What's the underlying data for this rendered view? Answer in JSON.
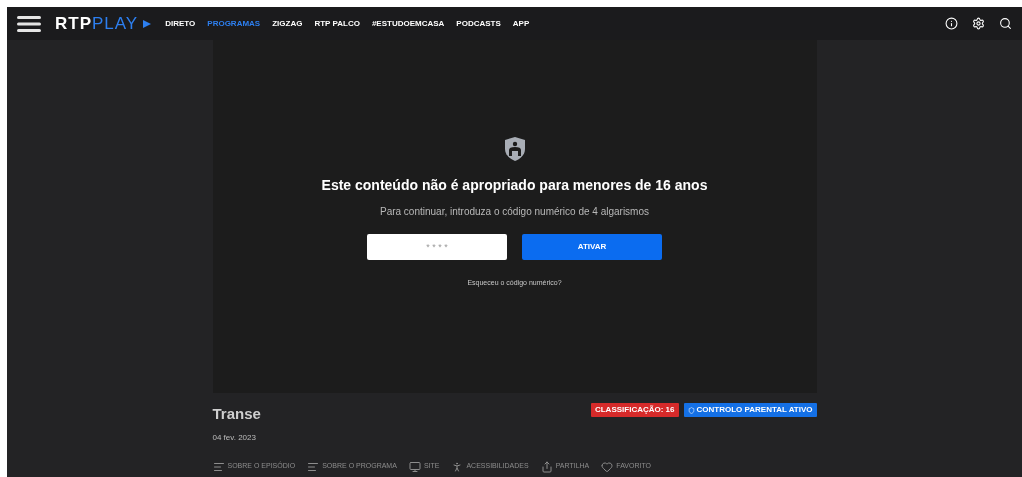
{
  "header": {
    "logo_rtp": "RTP",
    "logo_play": "PLAY",
    "nav": [
      {
        "label": "DIRETO",
        "selected": false
      },
      {
        "label": "PROGRAMAS",
        "selected": true
      },
      {
        "label": "ZIGZAG",
        "selected": false
      },
      {
        "label": "RTP PALCO",
        "selected": false
      },
      {
        "label": "#ESTUDOEMCASA",
        "selected": false
      },
      {
        "label": "PODCASTS",
        "selected": false
      },
      {
        "label": "APP",
        "selected": false
      }
    ]
  },
  "lock": {
    "title": "Este conteúdo não é apropriado para menores de 16 anos",
    "subtitle": "Para continuar, introduza o código numérico de 4 algarismos",
    "placeholder": "* * * *",
    "button": "ATIVAR",
    "link": "Esqueceu o código numérico?"
  },
  "episode": {
    "title": "Transe",
    "date": "04 fev. 2023",
    "badges": [
      {
        "label": "CLASSIFICAÇÃO: 16",
        "kind": "rating",
        "color": "#d62a2a"
      },
      {
        "label": "CONTROLO PARENTAL ATIVO",
        "kind": "parental",
        "color": "#1470e6"
      }
    ],
    "actions": [
      {
        "label": "SOBRE O EPISÓDIO",
        "kind": "lines"
      },
      {
        "label": "SOBRE O PROGRAMA",
        "kind": "lines"
      },
      {
        "label": "SITE",
        "kind": "monitor"
      },
      {
        "label": "ACESSIBILIDADES",
        "kind": "accessibility"
      },
      {
        "label": "PARTILHA",
        "kind": "share"
      },
      {
        "label": "FAVORITO",
        "kind": "heart"
      }
    ]
  }
}
